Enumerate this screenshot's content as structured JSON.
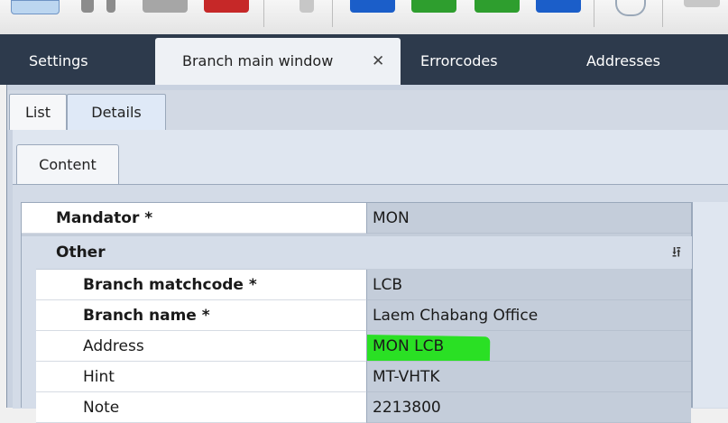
{
  "toolbar": {
    "buttons": [
      {
        "icon": "document-icon",
        "color": "#9ec3e8"
      },
      {
        "icon": "tool-icon",
        "color": "#8c8c8c"
      },
      {
        "icon": "tool-icon",
        "color": "#9a9a9a"
      },
      {
        "icon": "stop-icon",
        "color": "#c62828"
      },
      {
        "icon": "page-icon",
        "color": "#b5b5b5"
      },
      {
        "icon": "action-icon",
        "color": "#1b5ec9"
      },
      {
        "icon": "action-icon",
        "color": "#2e9e2e"
      },
      {
        "icon": "action-icon",
        "color": "#2e9e2e"
      },
      {
        "icon": "action-icon",
        "color": "#1b5ec9"
      },
      {
        "icon": "mail-icon",
        "color": "#9aa8b8"
      },
      {
        "icon": "tool-icon",
        "color": "#b5b5b5"
      }
    ]
  },
  "tabs": {
    "settings": "Settings",
    "branch": "Branch main window",
    "branch_close": "✕",
    "errorcodes": "Errorcodes",
    "addresses": "Addresses"
  },
  "subtabs": {
    "list": "List",
    "details": "Details"
  },
  "content_tab": "Content",
  "grid": {
    "mandator": {
      "label": "Mandator *",
      "value": "MON"
    },
    "category": {
      "label": "Other",
      "chevron": "⌃⌃"
    },
    "rows": [
      {
        "label": "Branch matchcode *",
        "value": "LCB"
      },
      {
        "label": "Branch name *",
        "value": "Laem Chabang Office"
      },
      {
        "label": "Address",
        "value": "MON LCB"
      },
      {
        "label": "Hint",
        "value": "MT-VHTK"
      },
      {
        "label": "Note",
        "value": "2213800"
      }
    ]
  },
  "colors": {
    "tabbar": "#2d3a4c",
    "highlight": "#22e01a"
  }
}
